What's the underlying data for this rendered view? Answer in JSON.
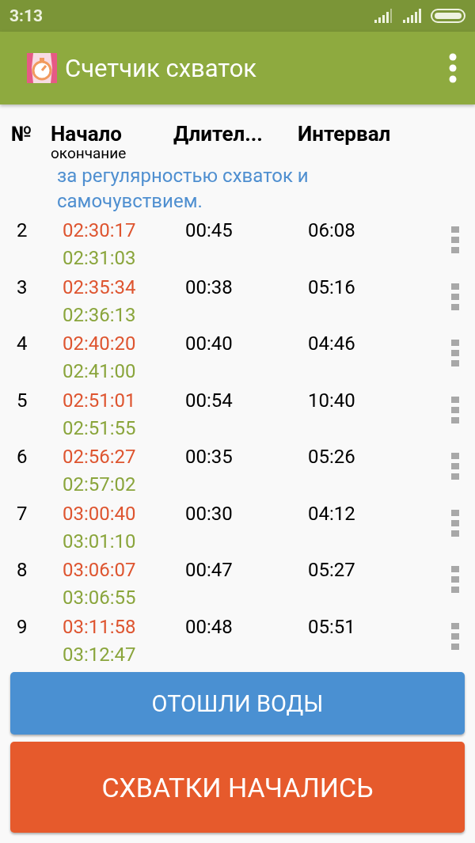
{
  "status_bar": {
    "time": "3:13"
  },
  "app_bar": {
    "title": "Счетчик схваток"
  },
  "columns": {
    "number": "№",
    "start": "Начало",
    "end": "окончание",
    "duration": "Длител...",
    "interval": "Интервал"
  },
  "note": "за регулярностью схваток и самочувствием.",
  "rows": [
    {
      "number": "2",
      "start": "02:30:17",
      "end": "02:31:03",
      "duration": "00:45",
      "interval": "06:08"
    },
    {
      "number": "3",
      "start": "02:35:34",
      "end": "02:36:13",
      "duration": "00:38",
      "interval": "05:16"
    },
    {
      "number": "4",
      "start": "02:40:20",
      "end": "02:41:00",
      "duration": "00:40",
      "interval": "04:46"
    },
    {
      "number": "5",
      "start": "02:51:01",
      "end": "02:51:55",
      "duration": "00:54",
      "interval": "10:40"
    },
    {
      "number": "6",
      "start": "02:56:27",
      "end": "02:57:02",
      "duration": "00:35",
      "interval": "05:26"
    },
    {
      "number": "7",
      "start": "03:00:40",
      "end": "03:01:10",
      "duration": "00:30",
      "interval": "04:12"
    },
    {
      "number": "8",
      "start": "03:06:07",
      "end": "03:06:55",
      "duration": "00:47",
      "interval": "05:27"
    },
    {
      "number": "9",
      "start": "03:11:58",
      "end": "03:12:47",
      "duration": "00:48",
      "interval": "05:51"
    }
  ],
  "buttons": [
    {
      "label": "ОТОШЛИ ВОДЫ",
      "kind": "water"
    },
    {
      "label": "СХВАТКИ НАЧАЛИСЬ",
      "kind": "contractions"
    }
  ]
}
